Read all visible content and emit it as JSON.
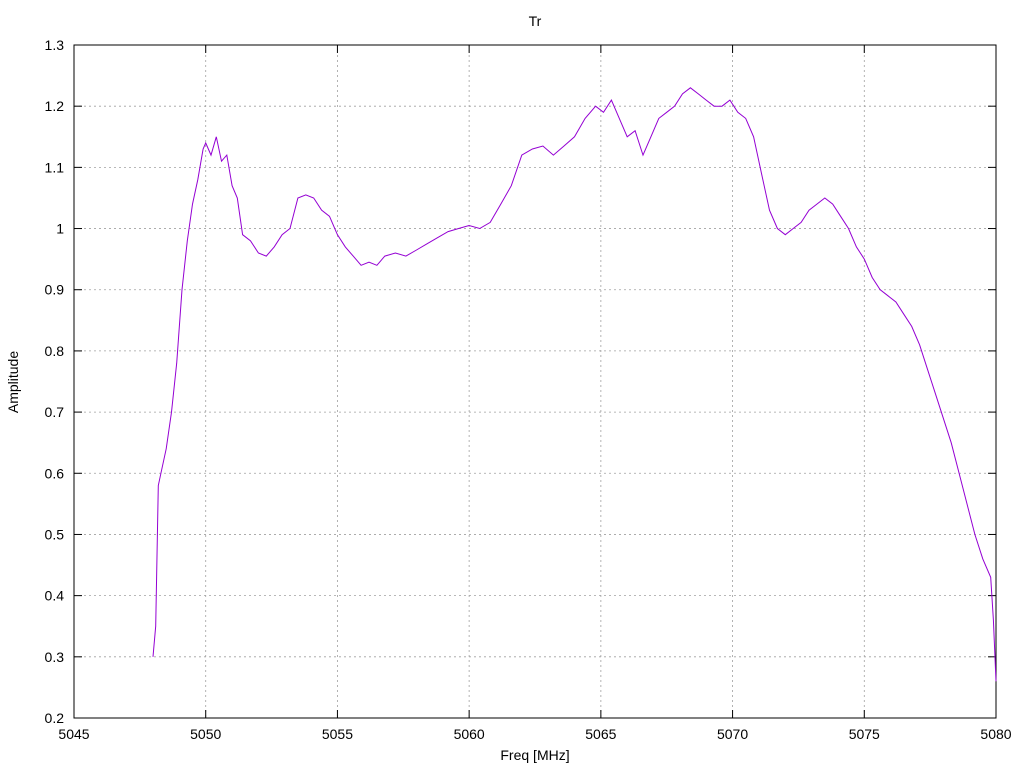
{
  "chart_data": {
    "type": "line",
    "title": "Tr",
    "xlabel": "Freq [MHz]",
    "ylabel": "Amplitude",
    "xlim": [
      5045,
      5080
    ],
    "ylim": [
      0.2,
      1.3
    ],
    "x_ticks": [
      5045,
      5050,
      5055,
      5060,
      5065,
      5070,
      5075,
      5080
    ],
    "y_ticks": [
      0.2,
      0.3,
      0.4,
      0.5,
      0.6,
      0.7,
      0.8,
      0.9,
      1,
      1.1,
      1.2,
      1.3
    ],
    "grid": true,
    "line_color": "#9400d3",
    "series": [
      {
        "x": [
          5048.0,
          5048.1,
          5048.2,
          5048.3,
          5048.5,
          5048.7,
          5048.9,
          5049.1,
          5049.3,
          5049.5,
          5049.7,
          5049.9,
          5050.0,
          5050.2,
          5050.4,
          5050.6,
          5050.8,
          5051.0,
          5051.2,
          5051.4,
          5051.7,
          5052.0,
          5052.3,
          5052.6,
          5052.9,
          5053.2,
          5053.5,
          5053.8,
          5054.1,
          5054.4,
          5054.7,
          5055.0,
          5055.3,
          5055.6,
          5055.9,
          5056.2,
          5056.5,
          5056.8,
          5057.2,
          5057.6,
          5058.0,
          5058.4,
          5058.8,
          5059.2,
          5059.6,
          5060.0,
          5060.4,
          5060.8,
          5061.2,
          5061.6,
          5062.0,
          5062.4,
          5062.8,
          5063.2,
          5063.6,
          5064.0,
          5064.4,
          5064.8,
          5065.1,
          5065.4,
          5065.7,
          5066.0,
          5066.3,
          5066.6,
          5066.9,
          5067.2,
          5067.5,
          5067.8,
          5068.1,
          5068.4,
          5068.7,
          5069.0,
          5069.3,
          5069.6,
          5069.9,
          5070.2,
          5070.5,
          5070.8,
          5071.1,
          5071.4,
          5071.7,
          5072.0,
          5072.3,
          5072.6,
          5072.9,
          5073.2,
          5073.5,
          5073.8,
          5074.1,
          5074.4,
          5074.7,
          5075.0,
          5075.3,
          5075.6,
          5075.9,
          5076.2,
          5076.5,
          5076.8,
          5077.1,
          5077.4,
          5077.7,
          5078.0,
          5078.3,
          5078.6,
          5078.9,
          5079.2,
          5079.5,
          5079.8,
          5079.9,
          5080.0
        ],
        "values": [
          0.3,
          0.35,
          0.58,
          0.6,
          0.64,
          0.7,
          0.78,
          0.9,
          0.98,
          1.04,
          1.08,
          1.13,
          1.14,
          1.12,
          1.15,
          1.11,
          1.12,
          1.07,
          1.05,
          0.99,
          0.98,
          0.96,
          0.955,
          0.97,
          0.99,
          1.0,
          1.05,
          1.055,
          1.05,
          1.03,
          1.02,
          0.99,
          0.97,
          0.955,
          0.94,
          0.945,
          0.94,
          0.955,
          0.96,
          0.955,
          0.965,
          0.975,
          0.985,
          0.995,
          1.0,
          1.005,
          1.0,
          1.01,
          1.04,
          1.07,
          1.12,
          1.13,
          1.135,
          1.12,
          1.135,
          1.15,
          1.18,
          1.2,
          1.19,
          1.21,
          1.18,
          1.15,
          1.16,
          1.12,
          1.15,
          1.18,
          1.19,
          1.2,
          1.22,
          1.23,
          1.22,
          1.21,
          1.2,
          1.2,
          1.21,
          1.19,
          1.18,
          1.15,
          1.09,
          1.03,
          1.0,
          0.99,
          1.0,
          1.01,
          1.03,
          1.04,
          1.05,
          1.04,
          1.02,
          1.0,
          0.97,
          0.95,
          0.92,
          0.9,
          0.89,
          0.88,
          0.86,
          0.84,
          0.81,
          0.77,
          0.73,
          0.69,
          0.65,
          0.6,
          0.55,
          0.5,
          0.46,
          0.43,
          0.36,
          0.26
        ]
      }
    ]
  }
}
